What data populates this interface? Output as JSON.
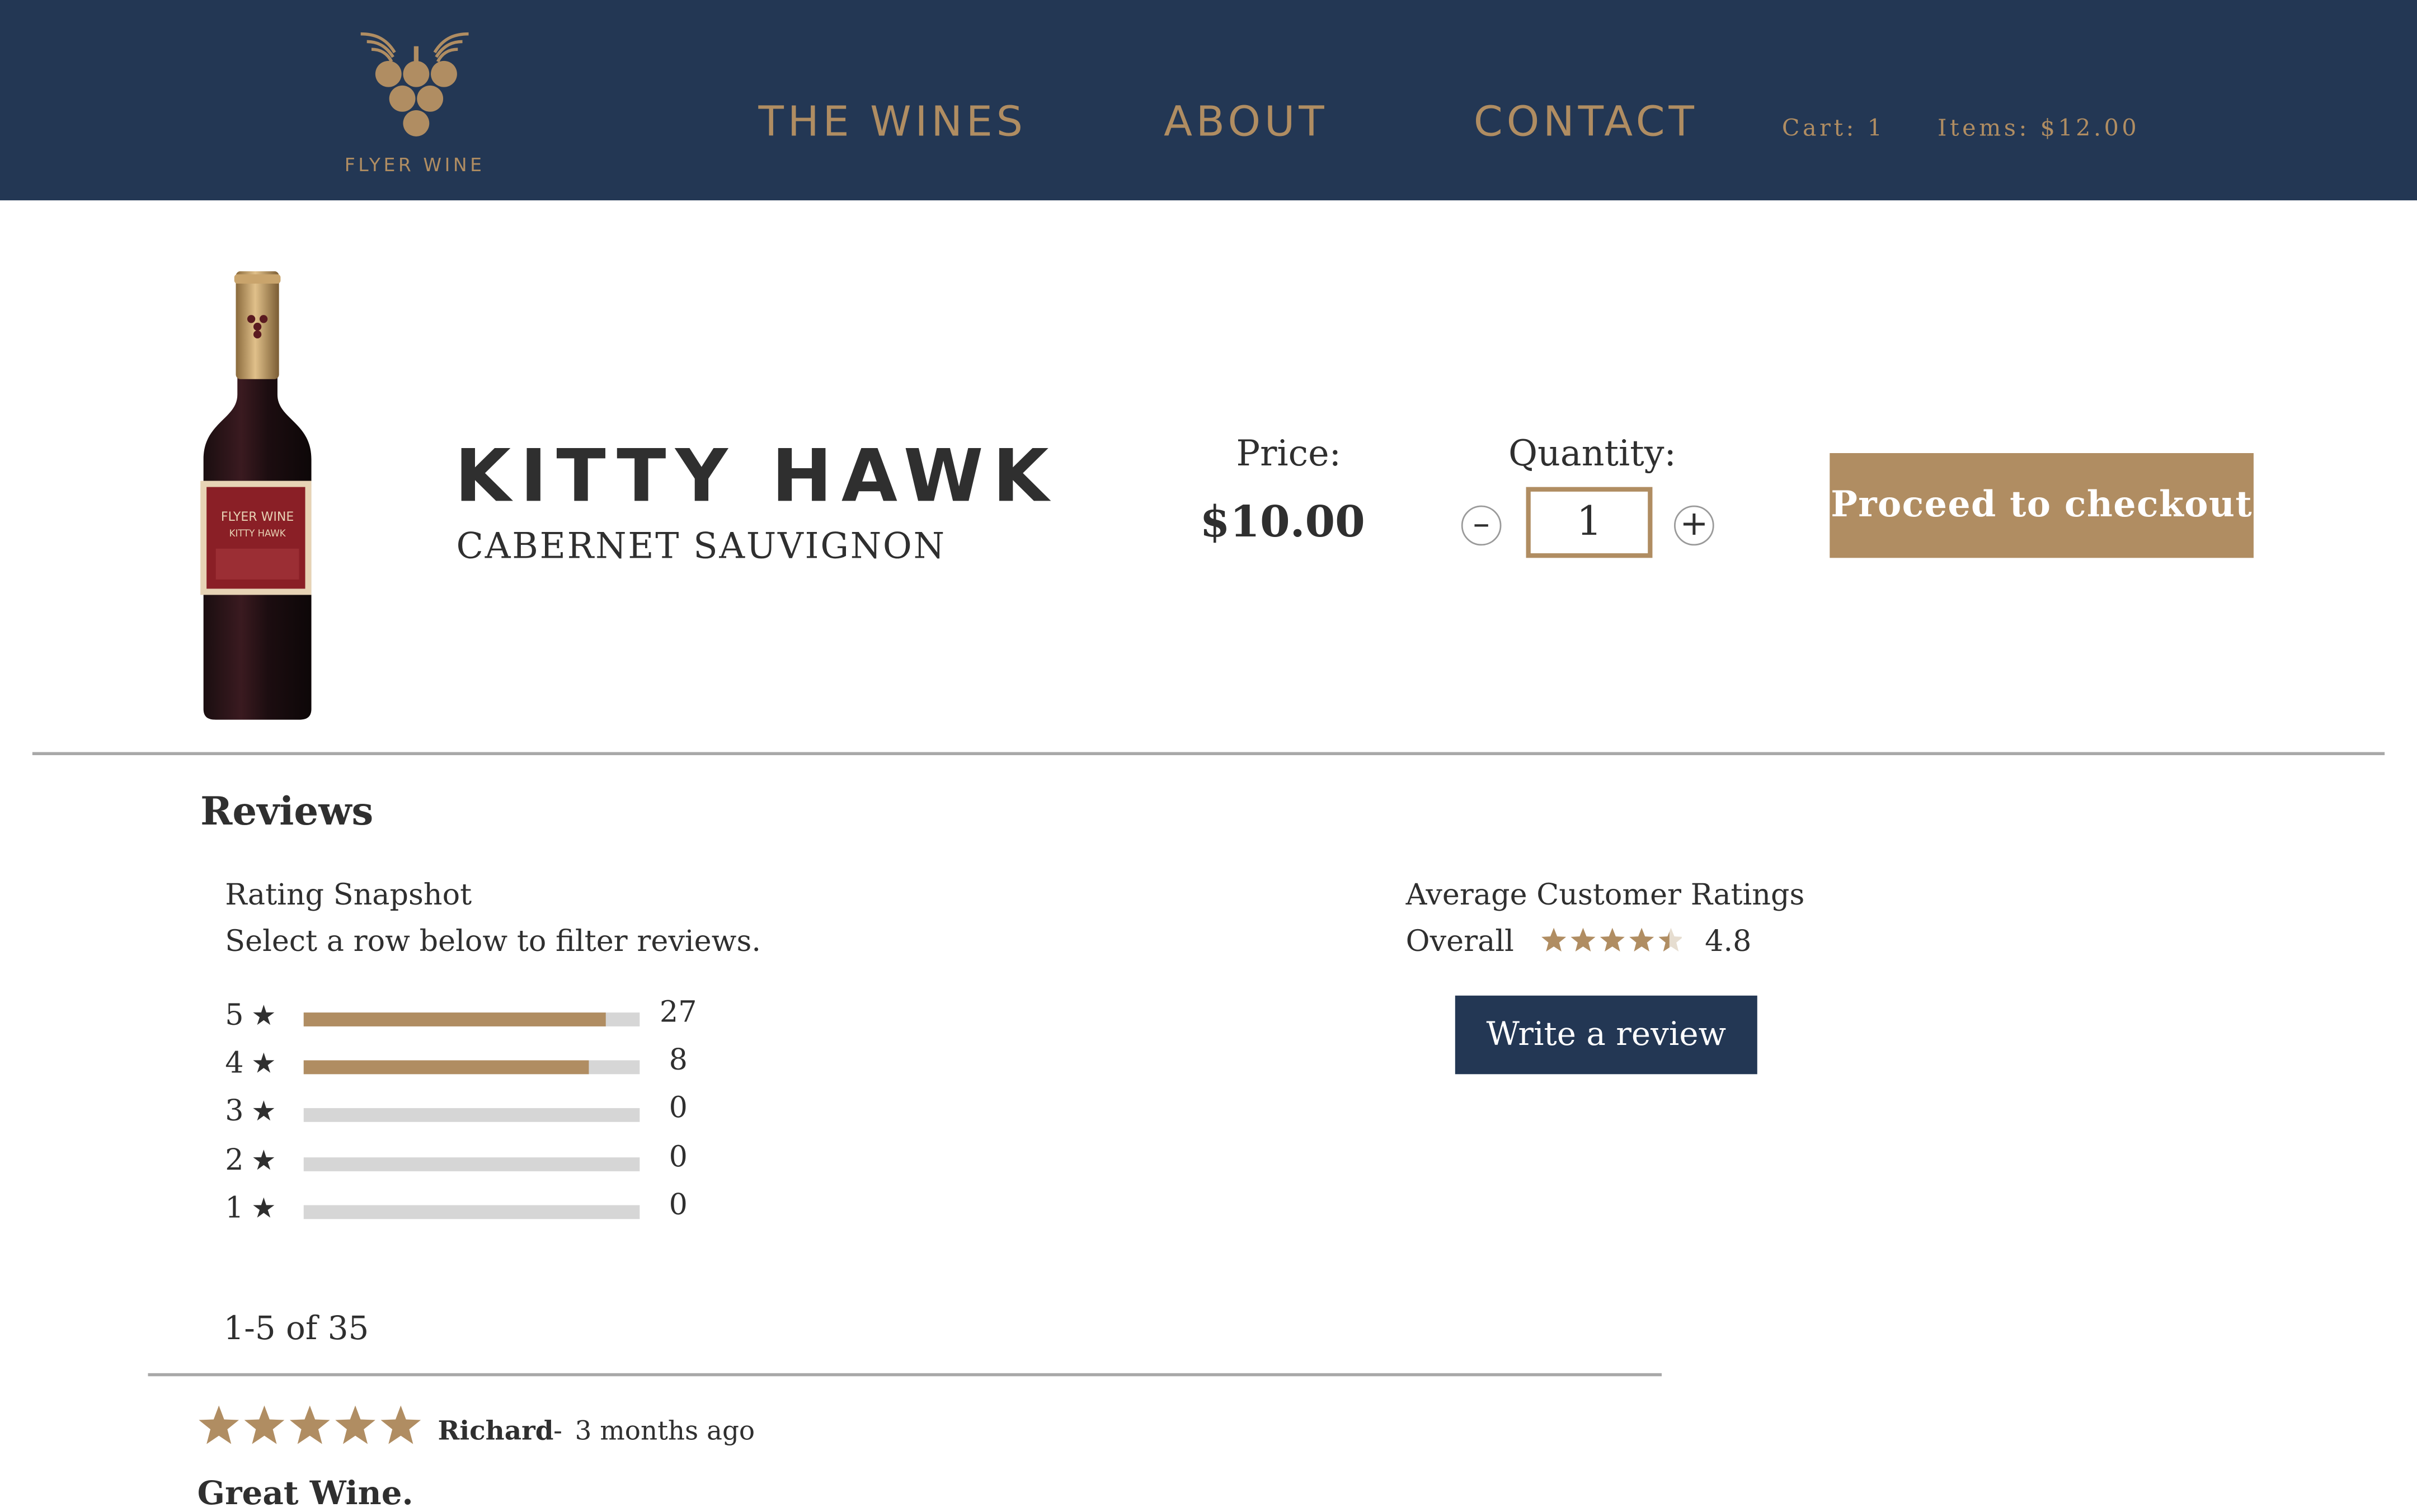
{
  "header": {
    "logo_text": "FLYER WINE",
    "nav": [
      "THE WINES",
      "ABOUT",
      "CONTACT"
    ],
    "cart_label": "Cart: 1",
    "items_label": "Items: $12.00"
  },
  "product": {
    "name": "KITTY HAWK",
    "variety": "CABERNET SAUVIGNON",
    "bottle_label_line1": "FLYER WINE",
    "bottle_label_line2": "KITTY HAWK",
    "price_label": "Price:",
    "price": "$10.00",
    "quantity_label": "Quantity:",
    "quantity": "1",
    "minus_symbol": "–",
    "plus_symbol": "+",
    "checkout_label": "Proceed to checkout"
  },
  "reviews": {
    "title": "Reviews",
    "snapshot_title": "Rating Snapshot",
    "snapshot_subtitle": "Select a row below to filter reviews.",
    "rows": [
      {
        "stars": "5",
        "count": "27",
        "fill": 0.9
      },
      {
        "stars": "4",
        "count": "8",
        "fill": 0.85
      },
      {
        "stars": "3",
        "count": "0",
        "fill": 0
      },
      {
        "stars": "2",
        "count": "0",
        "fill": 0
      },
      {
        "stars": "1",
        "count": "0",
        "fill": 0
      }
    ],
    "average_title": "Average Customer Ratings",
    "overall_label": "Overall",
    "overall_value": "4.8",
    "overall_stars": 4.5,
    "write_review_label": "Write a review",
    "pagination": "1-5 of 35"
  },
  "first_review": {
    "rating": 5,
    "author": "Richard",
    "separator": "-",
    "time": "3 months ago",
    "title": "Great Wine."
  },
  "colors": {
    "navy": "#233754",
    "gold": "#b08d62",
    "text": "#2f2f2f"
  }
}
